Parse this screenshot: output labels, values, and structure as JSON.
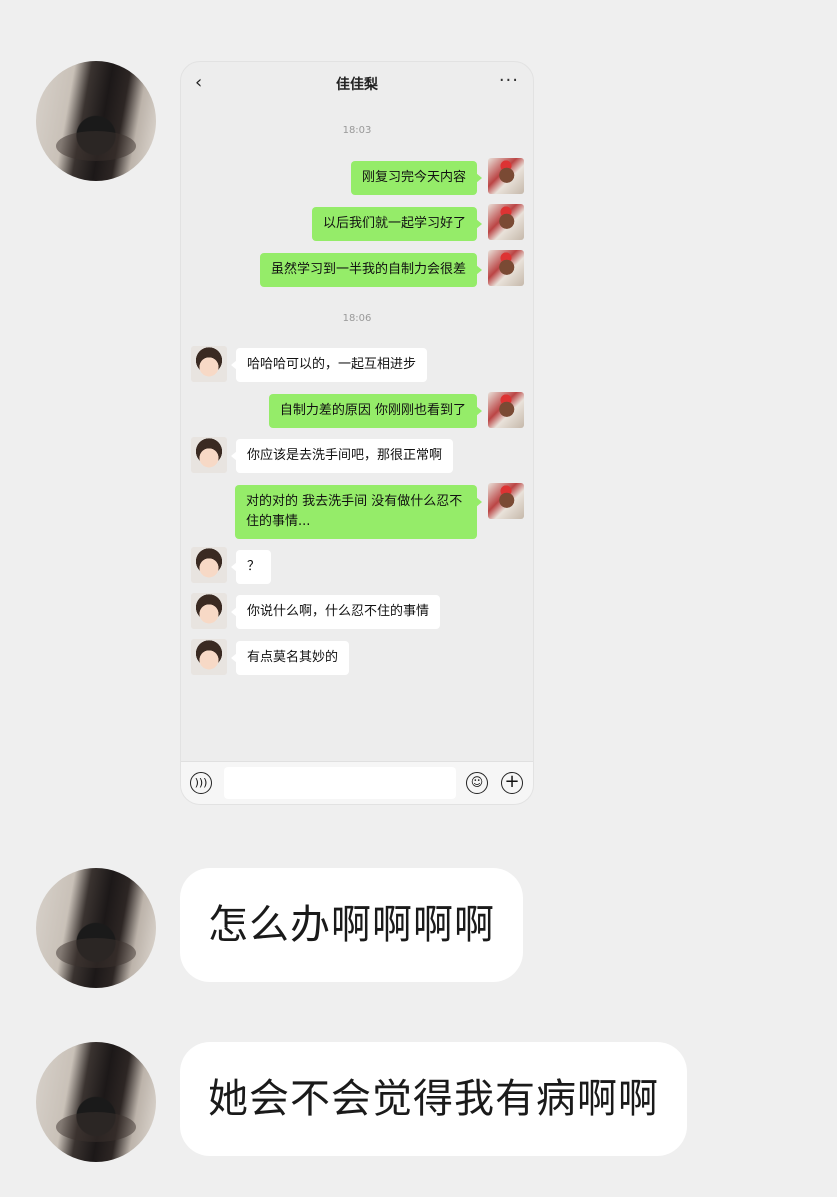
{
  "chat": {
    "title": "佳佳梨",
    "back_icon": "‹",
    "more_icon": "···",
    "time1": "18:03",
    "time2": "18:06",
    "messages": [
      "刚复习完今天内容",
      "以后我们就一起学习好了",
      "虽然学习到一半我的自制力会很差",
      "哈哈哈可以的，一起互相进步",
      "自制力差的原因 你刚刚也看到了",
      "你应该是去洗手间吧，那很正常啊",
      "对的对的 我去洗手间 没有做什么忍不住的事情...",
      "？",
      "你说什么啊，什么忍不住的事情",
      "有点莫名其妙的"
    ],
    "input_placeholder": ""
  },
  "outer": {
    "messages": [
      "怎么办啊啊啊啊",
      "她会不会觉得我有病啊啊"
    ]
  },
  "icons": {
    "voice": "voice-icon",
    "emoji": "emoji-icon",
    "plus": "plus-icon"
  }
}
